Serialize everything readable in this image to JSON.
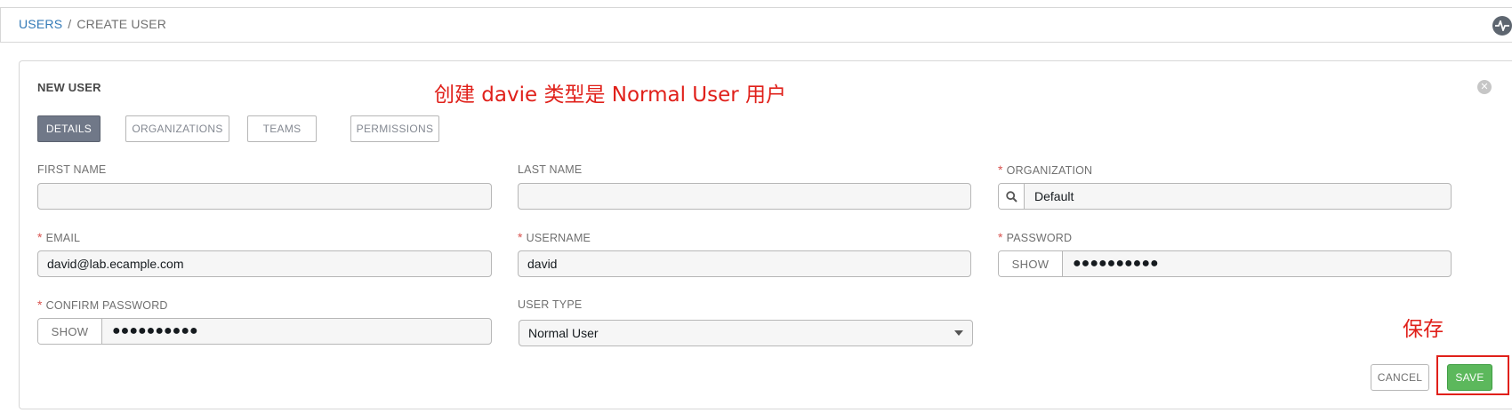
{
  "breadcrumb": {
    "users": "USERS",
    "separator": "/",
    "current": "CREATE USER"
  },
  "header": {
    "activity_icon": "activity-stream-icon"
  },
  "panel": {
    "title": "NEW USER",
    "close_icon": "close-circle-icon"
  },
  "annotations": {
    "title_note": "创建 davie 类型是 Normal User 用户",
    "save_note": "保存"
  },
  "tabs": [
    {
      "label": "DETAILS",
      "active": true
    },
    {
      "label": "ORGANIZATIONS",
      "active": false
    },
    {
      "label": "TEAMS",
      "active": false
    },
    {
      "label": "PERMISSIONS",
      "active": false
    }
  ],
  "form": {
    "first_name": {
      "label": "FIRST NAME",
      "value": ""
    },
    "last_name": {
      "label": "LAST NAME",
      "value": ""
    },
    "organization": {
      "label": "ORGANIZATION",
      "required": true,
      "value": "Default",
      "icon": "search-icon"
    },
    "email": {
      "label": "EMAIL",
      "required": true,
      "value": "david@lab.ecample.com"
    },
    "username": {
      "label": "USERNAME",
      "required": true,
      "value": "david"
    },
    "password": {
      "label": "PASSWORD",
      "required": true,
      "show_label": "SHOW",
      "value": "●●●●●●●●●●"
    },
    "confirm_password": {
      "label": "CONFIRM PASSWORD",
      "required": true,
      "show_label": "SHOW",
      "value": "●●●●●●●●●●"
    },
    "user_type": {
      "label": "USER TYPE",
      "value": "Normal User"
    }
  },
  "actions": {
    "cancel": "CANCEL",
    "save": "SAVE"
  },
  "colors": {
    "link": "#337ab7",
    "required": "#d9534f",
    "save": "#5cb85c",
    "annotation": "#e0201a",
    "active_tab": "#707888"
  }
}
